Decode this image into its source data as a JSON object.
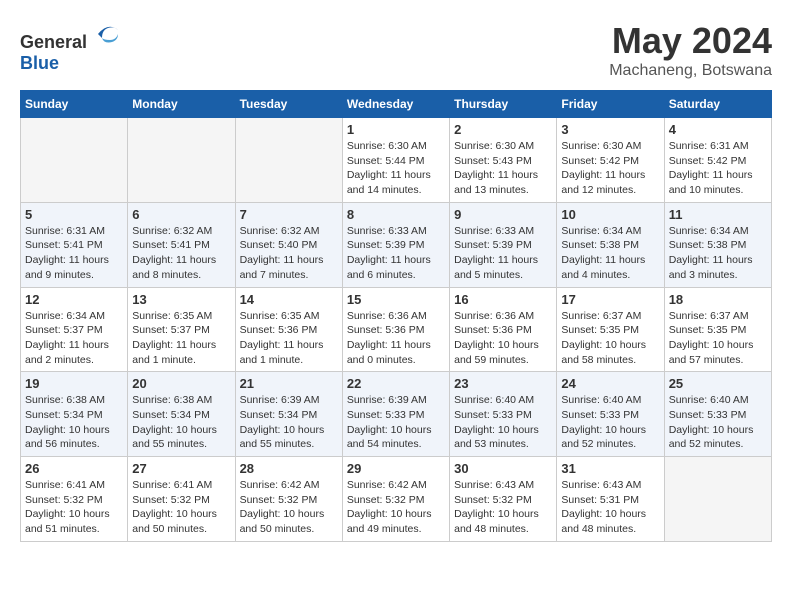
{
  "header": {
    "logo_general": "General",
    "logo_blue": "Blue",
    "month_year": "May 2024",
    "location": "Machaneng, Botswana"
  },
  "weekdays": [
    "Sunday",
    "Monday",
    "Tuesday",
    "Wednesday",
    "Thursday",
    "Friday",
    "Saturday"
  ],
  "weeks": [
    [
      {
        "day": "",
        "info": ""
      },
      {
        "day": "",
        "info": ""
      },
      {
        "day": "",
        "info": ""
      },
      {
        "day": "1",
        "info": "Sunrise: 6:30 AM\nSunset: 5:44 PM\nDaylight: 11 hours\nand 14 minutes."
      },
      {
        "day": "2",
        "info": "Sunrise: 6:30 AM\nSunset: 5:43 PM\nDaylight: 11 hours\nand 13 minutes."
      },
      {
        "day": "3",
        "info": "Sunrise: 6:30 AM\nSunset: 5:42 PM\nDaylight: 11 hours\nand 12 minutes."
      },
      {
        "day": "4",
        "info": "Sunrise: 6:31 AM\nSunset: 5:42 PM\nDaylight: 11 hours\nand 10 minutes."
      }
    ],
    [
      {
        "day": "5",
        "info": "Sunrise: 6:31 AM\nSunset: 5:41 PM\nDaylight: 11 hours\nand 9 minutes."
      },
      {
        "day": "6",
        "info": "Sunrise: 6:32 AM\nSunset: 5:41 PM\nDaylight: 11 hours\nand 8 minutes."
      },
      {
        "day": "7",
        "info": "Sunrise: 6:32 AM\nSunset: 5:40 PM\nDaylight: 11 hours\nand 7 minutes."
      },
      {
        "day": "8",
        "info": "Sunrise: 6:33 AM\nSunset: 5:39 PM\nDaylight: 11 hours\nand 6 minutes."
      },
      {
        "day": "9",
        "info": "Sunrise: 6:33 AM\nSunset: 5:39 PM\nDaylight: 11 hours\nand 5 minutes."
      },
      {
        "day": "10",
        "info": "Sunrise: 6:34 AM\nSunset: 5:38 PM\nDaylight: 11 hours\nand 4 minutes."
      },
      {
        "day": "11",
        "info": "Sunrise: 6:34 AM\nSunset: 5:38 PM\nDaylight: 11 hours\nand 3 minutes."
      }
    ],
    [
      {
        "day": "12",
        "info": "Sunrise: 6:34 AM\nSunset: 5:37 PM\nDaylight: 11 hours\nand 2 minutes."
      },
      {
        "day": "13",
        "info": "Sunrise: 6:35 AM\nSunset: 5:37 PM\nDaylight: 11 hours\nand 1 minute."
      },
      {
        "day": "14",
        "info": "Sunrise: 6:35 AM\nSunset: 5:36 PM\nDaylight: 11 hours\nand 1 minute."
      },
      {
        "day": "15",
        "info": "Sunrise: 6:36 AM\nSunset: 5:36 PM\nDaylight: 11 hours\nand 0 minutes."
      },
      {
        "day": "16",
        "info": "Sunrise: 6:36 AM\nSunset: 5:36 PM\nDaylight: 10 hours\nand 59 minutes."
      },
      {
        "day": "17",
        "info": "Sunrise: 6:37 AM\nSunset: 5:35 PM\nDaylight: 10 hours\nand 58 minutes."
      },
      {
        "day": "18",
        "info": "Sunrise: 6:37 AM\nSunset: 5:35 PM\nDaylight: 10 hours\nand 57 minutes."
      }
    ],
    [
      {
        "day": "19",
        "info": "Sunrise: 6:38 AM\nSunset: 5:34 PM\nDaylight: 10 hours\nand 56 minutes."
      },
      {
        "day": "20",
        "info": "Sunrise: 6:38 AM\nSunset: 5:34 PM\nDaylight: 10 hours\nand 55 minutes."
      },
      {
        "day": "21",
        "info": "Sunrise: 6:39 AM\nSunset: 5:34 PM\nDaylight: 10 hours\nand 55 minutes."
      },
      {
        "day": "22",
        "info": "Sunrise: 6:39 AM\nSunset: 5:33 PM\nDaylight: 10 hours\nand 54 minutes."
      },
      {
        "day": "23",
        "info": "Sunrise: 6:40 AM\nSunset: 5:33 PM\nDaylight: 10 hours\nand 53 minutes."
      },
      {
        "day": "24",
        "info": "Sunrise: 6:40 AM\nSunset: 5:33 PM\nDaylight: 10 hours\nand 52 minutes."
      },
      {
        "day": "25",
        "info": "Sunrise: 6:40 AM\nSunset: 5:33 PM\nDaylight: 10 hours\nand 52 minutes."
      }
    ],
    [
      {
        "day": "26",
        "info": "Sunrise: 6:41 AM\nSunset: 5:32 PM\nDaylight: 10 hours\nand 51 minutes."
      },
      {
        "day": "27",
        "info": "Sunrise: 6:41 AM\nSunset: 5:32 PM\nDaylight: 10 hours\nand 50 minutes."
      },
      {
        "day": "28",
        "info": "Sunrise: 6:42 AM\nSunset: 5:32 PM\nDaylight: 10 hours\nand 50 minutes."
      },
      {
        "day": "29",
        "info": "Sunrise: 6:42 AM\nSunset: 5:32 PM\nDaylight: 10 hours\nand 49 minutes."
      },
      {
        "day": "30",
        "info": "Sunrise: 6:43 AM\nSunset: 5:32 PM\nDaylight: 10 hours\nand 48 minutes."
      },
      {
        "day": "31",
        "info": "Sunrise: 6:43 AM\nSunset: 5:31 PM\nDaylight: 10 hours\nand 48 minutes."
      },
      {
        "day": "",
        "info": ""
      }
    ]
  ]
}
